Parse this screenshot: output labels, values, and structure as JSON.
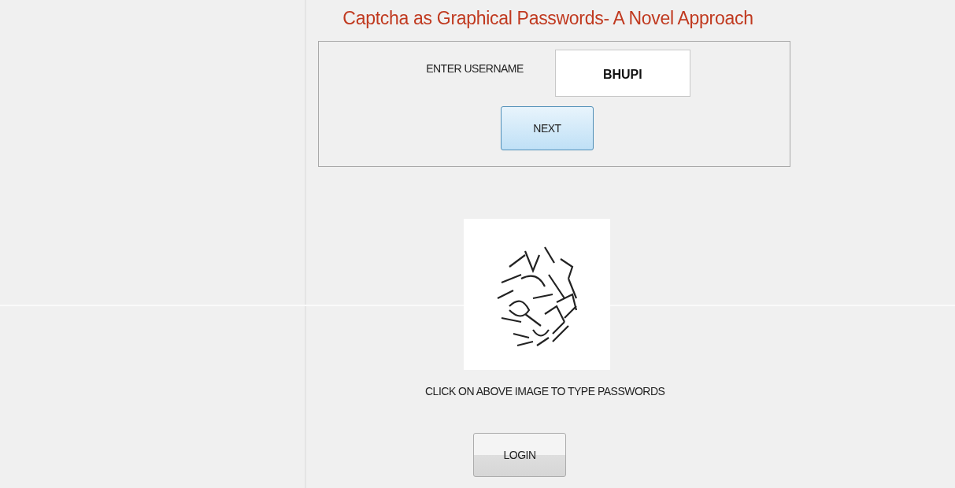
{
  "title": "Captcha as Graphical Passwords- A Novel Approach",
  "username": {
    "label": "ENTER USERNAME",
    "value": "BHUPI"
  },
  "next_button": "NEXT",
  "captcha": {
    "caption": "CLICK ON ABOVE IMAGE TO TYPE PASSWORDS"
  },
  "login_button": "LOGIN"
}
